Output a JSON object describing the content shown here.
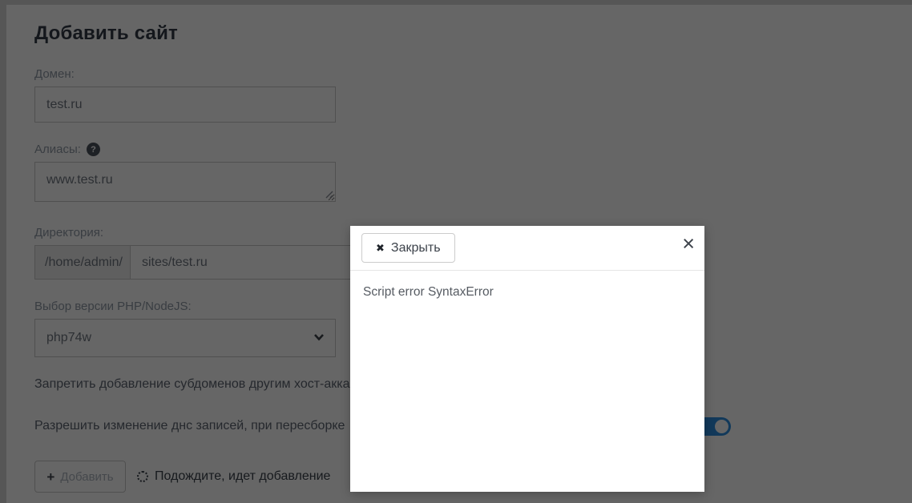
{
  "page": {
    "title": "Добавить сайт",
    "form": {
      "domain": {
        "label": "Домен:",
        "value": "test.ru"
      },
      "aliases": {
        "label": "Алиасы:",
        "value": "www.test.ru"
      },
      "directory": {
        "label": "Директория:",
        "prefix": "/home/admin/",
        "value": "sites/test.ru"
      },
      "php_version": {
        "label": "Выбор версии PHP/NodeJS:",
        "selected": "php74w"
      },
      "option_rows": [
        {
          "label": "Запретить добавление субдоменов другим хост-акка"
        },
        {
          "label": "Разрешить изменение днс записей, при пересборке",
          "toggle_state": "on"
        }
      ],
      "submit_label": "Добавить",
      "progress_text": "Подождите, идет добавление"
    }
  },
  "modal": {
    "close_button_label": "Закрыть",
    "body_text": "Script error SyntaxError"
  },
  "icons": {
    "plus": "+",
    "help": "?",
    "close_bold": "✖",
    "close_thin": "×"
  },
  "colors": {
    "toggle_on": "#2f90e0",
    "overlay": "rgba(0,0,0,0.6)"
  }
}
